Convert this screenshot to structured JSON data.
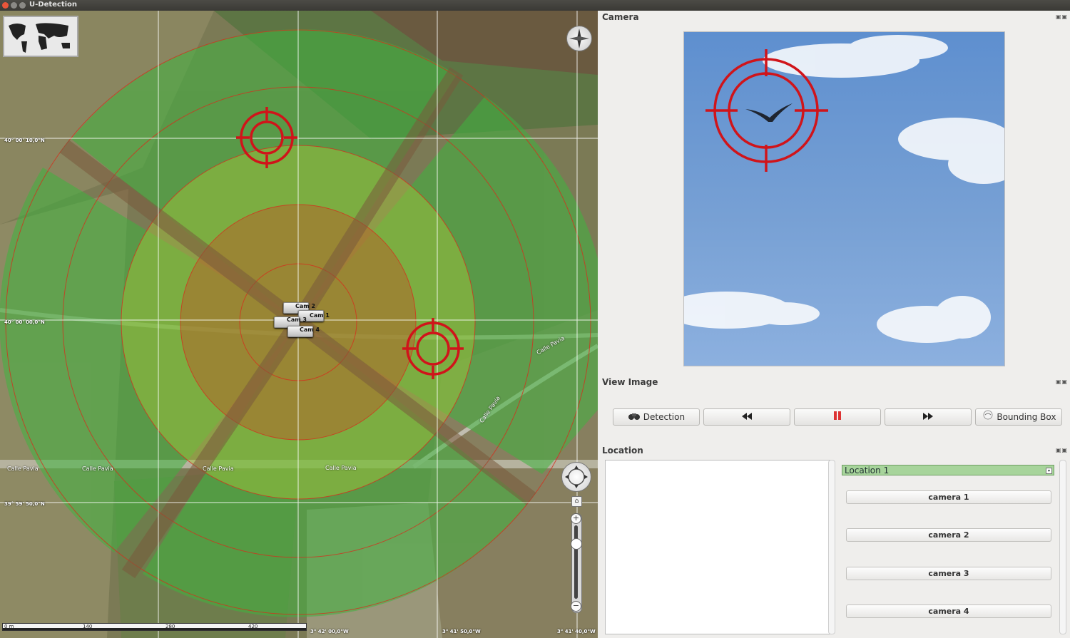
{
  "window": {
    "title": "U-Detection"
  },
  "map": {
    "coords": {
      "lat_top": "40° 00' 10,0\"N",
      "lat_mid": "40° 00' 00,0\"N",
      "lat_bottom": "39° 59' 50,0\"N",
      "lon_left": "3° 42' 00,0\"W",
      "lon_mid": "3° 41' 50,0\"W",
      "lon_right": "3° 41' 40,0\"W"
    },
    "cameras": [
      "Cam 2",
      "Cam 1",
      "Cam 3",
      "Cam 4"
    ],
    "streets": [
      "Calle Pavia",
      "Calle Pavia",
      "Calle Pavia",
      "Calle Pavia",
      "Calle Pavia",
      "Calle Pavia"
    ],
    "scale": {
      "labels": [
        "0 m",
        "140",
        "280",
        "420"
      ]
    }
  },
  "camera_dock": {
    "title": "Camera"
  },
  "view_image_dock": {
    "title": "View Image",
    "buttons": {
      "detection": "Detection",
      "bounding_box": "Bounding Box"
    }
  },
  "location_dock": {
    "title": "Location",
    "selected_location": "Location 1",
    "cameras": [
      "camera 1",
      "camera 2",
      "camera 3",
      "camera 4"
    ]
  },
  "colors": {
    "target_red": "#d0141a",
    "selection_green": "#a7d49b"
  },
  "icons": [
    "binoculars-icon",
    "rewind-icon",
    "pause-icon",
    "fast-forward-icon",
    "bounding-box-icon",
    "compass-icon",
    "home-icon"
  ]
}
